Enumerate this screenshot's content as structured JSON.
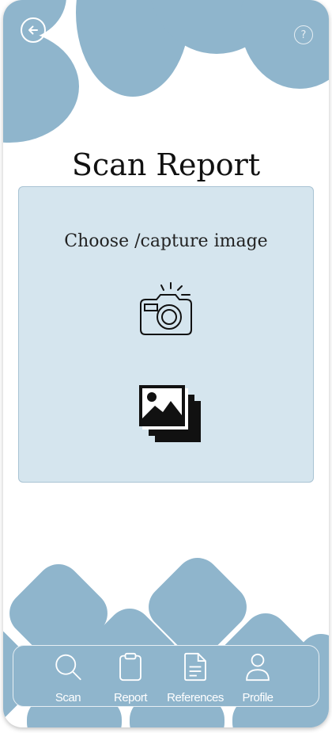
{
  "screen": {
    "title": "Scan Report",
    "accent_color": "#8fb5cc",
    "card_color": "#d5e5ee"
  },
  "topbar": {
    "back_icon": "arrow-left-circle-icon",
    "help_label": "?"
  },
  "upload_card": {
    "label": "Choose /capture image",
    "camera_icon": "camera-icon",
    "gallery_icon": "gallery-icon"
  },
  "nav": {
    "items": [
      {
        "label": "Scan",
        "icon": "search-icon"
      },
      {
        "label": "Report",
        "icon": "clipboard-icon"
      },
      {
        "label": "References",
        "icon": "document-icon"
      },
      {
        "label": "Profile",
        "icon": "user-icon"
      }
    ]
  }
}
